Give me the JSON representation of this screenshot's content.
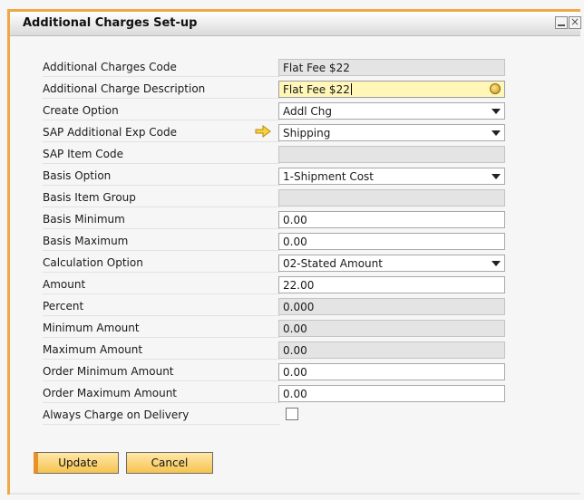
{
  "window": {
    "title": "Additional Charges Set-up"
  },
  "form": {
    "fields": [
      {
        "label": "Additional Charges Code",
        "value": "Flat Fee $22",
        "type": "readonly"
      },
      {
        "label": "Additional Charge Description",
        "value": "Flat Fee $22",
        "type": "text-focused"
      },
      {
        "label": "Create Option",
        "value": "Addl Chg",
        "type": "dropdown"
      },
      {
        "label": "SAP Additional Exp Code",
        "value": "Shipping",
        "type": "dropdown-link"
      },
      {
        "label": "SAP Item Code",
        "value": "",
        "type": "readonly"
      },
      {
        "label": "Basis Option",
        "value": "1-Shipment Cost",
        "type": "dropdown"
      },
      {
        "label": "Basis Item Group",
        "value": "",
        "type": "readonly"
      },
      {
        "label": "Basis Minimum",
        "value": "0.00",
        "type": "text"
      },
      {
        "label": "Basis Maximum",
        "value": "0.00",
        "type": "text"
      },
      {
        "label": "Calculation Option",
        "value": "02-Stated Amount",
        "type": "dropdown"
      },
      {
        "label": "Amount",
        "value": "22.00",
        "type": "text"
      },
      {
        "label": "Percent",
        "value": "0.000",
        "type": "readonly"
      },
      {
        "label": "Minimum Amount",
        "value": "0.00",
        "type": "readonly"
      },
      {
        "label": "Maximum Amount",
        "value": "0.00",
        "type": "readonly"
      },
      {
        "label": "Order Minimum Amount",
        "value": "0.00",
        "type": "text"
      },
      {
        "label": "Order Maximum Amount",
        "value": "0.00",
        "type": "text"
      },
      {
        "label": "Always Charge on Delivery",
        "checked": false,
        "type": "checkbox"
      }
    ]
  },
  "buttons": {
    "update": "Update",
    "cancel": "Cancel"
  },
  "colors": {
    "frame_accent": "#f0a846",
    "button_fill": "#f6c44f",
    "focused_field": "#fff6b8",
    "readonly_field": "#e4e4e4"
  }
}
